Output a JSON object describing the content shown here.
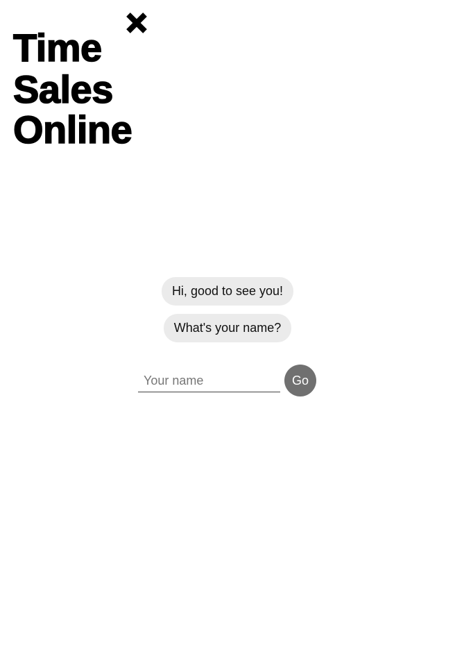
{
  "logo": {
    "line1": "Time",
    "line2": "Sales",
    "line3": "Online",
    "mark_icon": "cross-mark-icon"
  },
  "chat": {
    "messages": [
      "Hi, good to see you!",
      "What's your name?"
    ]
  },
  "form": {
    "name_placeholder": "Your name",
    "name_value": "",
    "go_label": "Go"
  },
  "colors": {
    "bubble_bg": "#ebebeb",
    "button_bg": "#707070",
    "text": "#111111"
  }
}
